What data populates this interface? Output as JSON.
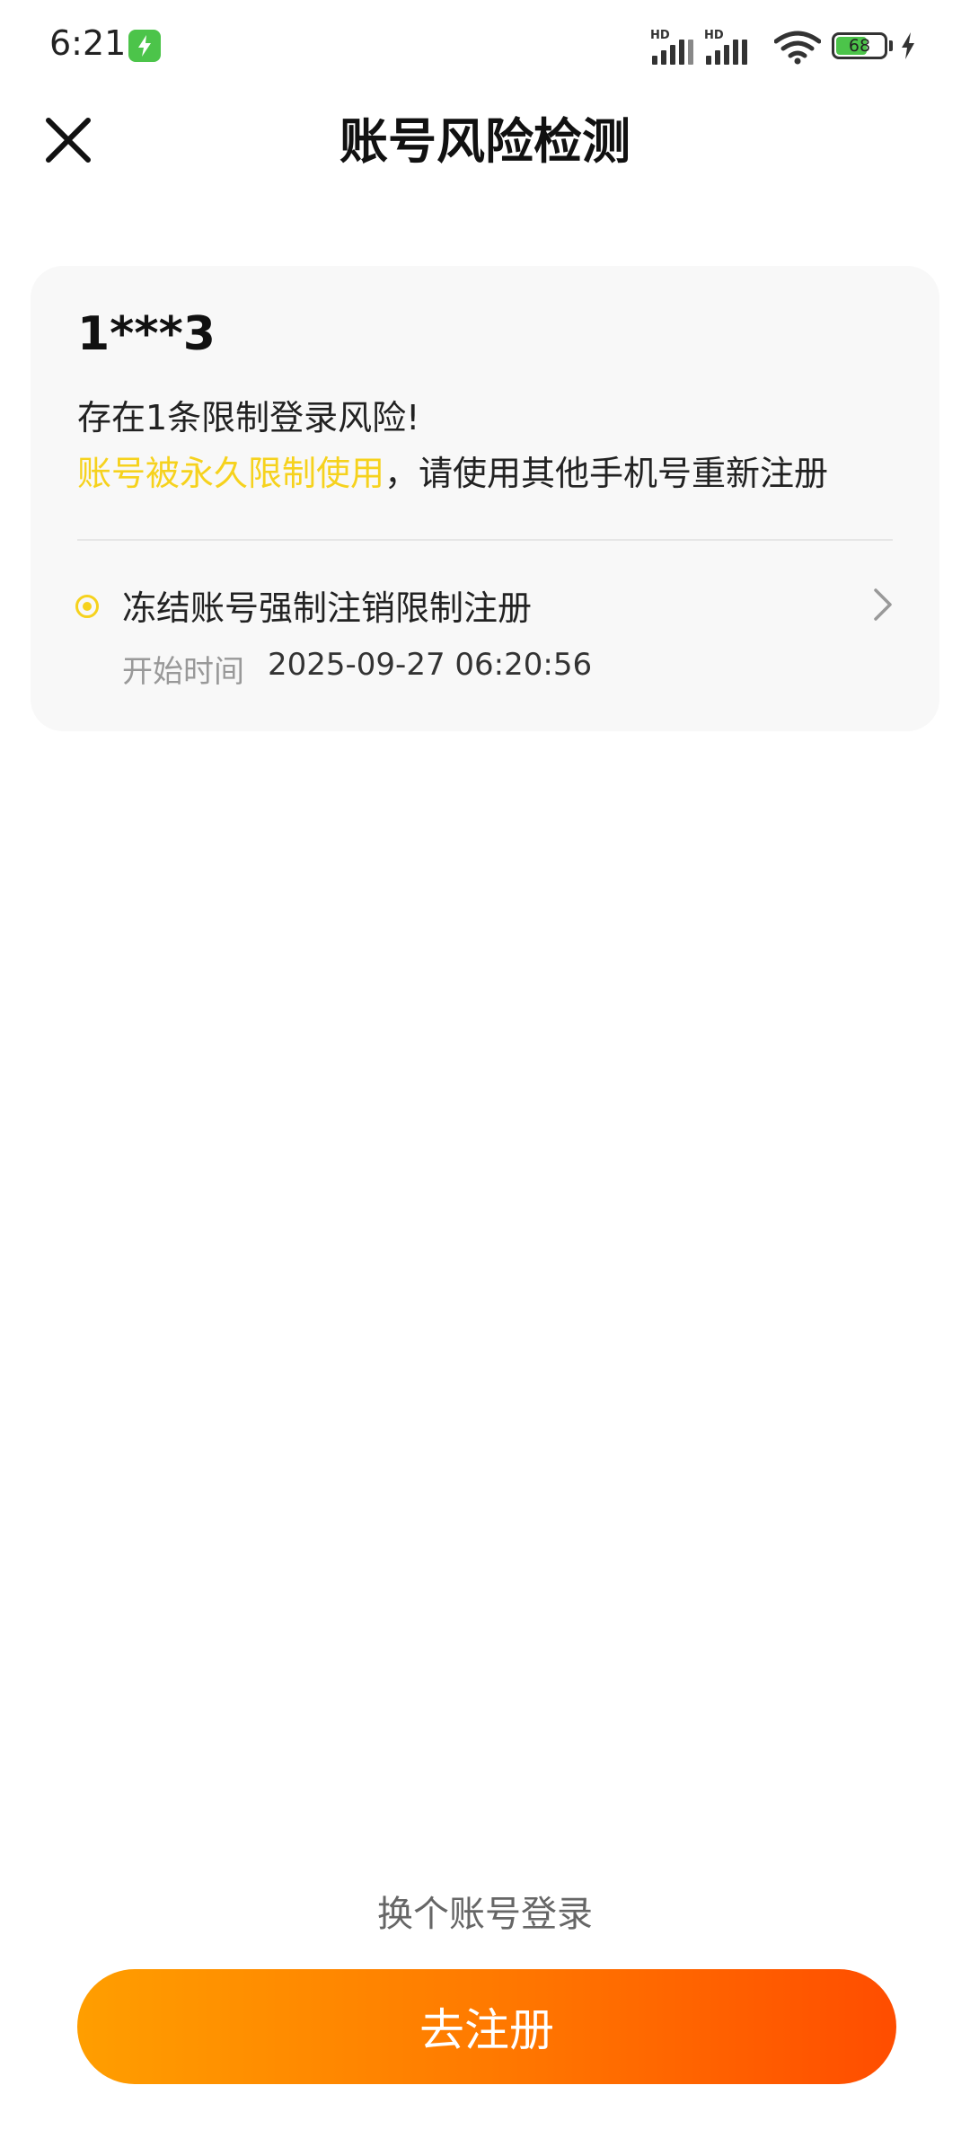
{
  "status_bar": {
    "time": "6:21",
    "signal_label": "HD",
    "battery_percent": "68",
    "battery_level": 0.68,
    "colors": {
      "battery_fill": "#4cc44a"
    }
  },
  "header": {
    "title": "账号风险检测",
    "close_icon": "close-icon"
  },
  "risk_card": {
    "account": "1***3",
    "risk_count_text": "存在1条限制登录风险!",
    "risk_highlight": "账号被永久限制使用",
    "risk_message": "，请使用其他手机号重新注册",
    "items": [
      {
        "title": "冻结账号强制注销限制注册",
        "time_label": "开始时间",
        "time_value": "2025-09-27 06:20:56"
      }
    ],
    "colors": {
      "highlight": "#f6d21d",
      "card_bg": "#f8f8f8"
    }
  },
  "footer": {
    "switch_account_label": "换个账号登录",
    "register_button_label": "去注册",
    "colors": {
      "button_start": "#ff9e00",
      "button_end": "#ff4d00"
    }
  }
}
